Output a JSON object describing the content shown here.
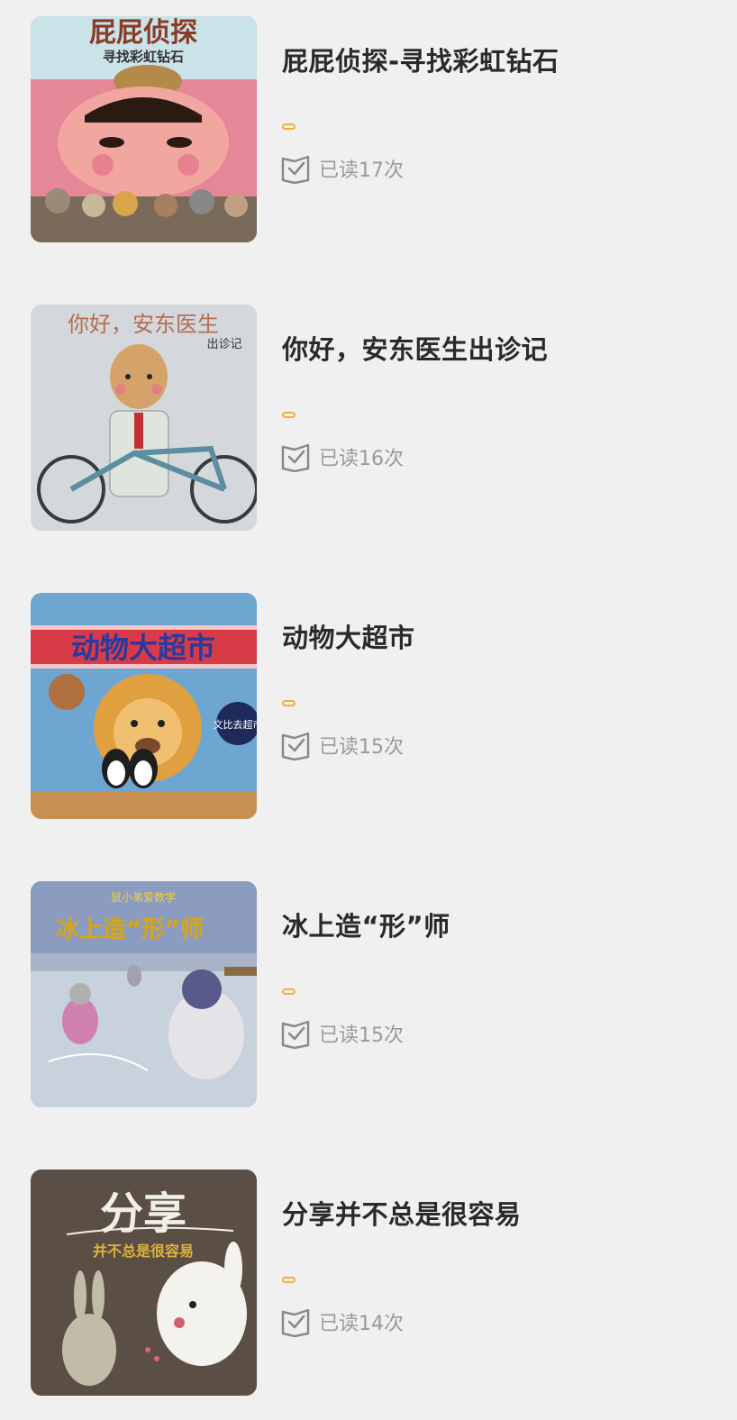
{
  "books": [
    {
      "title": "屁屁侦探-寻找彩虹钻石",
      "read_count": "已读17次",
      "cover": {
        "heading": "屁屁侦探",
        "subheading": "寻找彩虹钻石",
        "bg": "#e58796",
        "text_color": "#8a3b26"
      }
    },
    {
      "title": "你好，安东医生出诊记",
      "read_count": "已读16次",
      "cover": {
        "heading": "你好，安东医生",
        "subheading": "出诊记",
        "bg": "#d4d8dc",
        "text_color": "#b26f50"
      }
    },
    {
      "title": "动物大超市",
      "read_count": "已读15次",
      "cover": {
        "heading": "动物大超市",
        "subheading": "文比去超市",
        "bg": "#6ea6d2",
        "text_color": "#2b3a9a"
      }
    },
    {
      "title": "冰上造“形”师",
      "read_count": "已读15次",
      "cover": {
        "heading": "冰上造“形”师",
        "subheading": "鼠小弟爱数学",
        "bg": "#a8b3c8",
        "text_color": "#d8a514"
      }
    },
    {
      "title": "分享并不总是很容易",
      "read_count": "已读14次",
      "cover": {
        "heading": "分享",
        "subheading": "并不总是很容易",
        "bg": "#5b4f45",
        "text_color": "#f2efe8"
      }
    }
  ],
  "colors": {
    "accent": "#f2b233",
    "title": "#2a2a2a",
    "meta": "#9a9a9a",
    "background": "#f0f0f0"
  },
  "icons": {
    "read": "checkbox-book-icon"
  }
}
